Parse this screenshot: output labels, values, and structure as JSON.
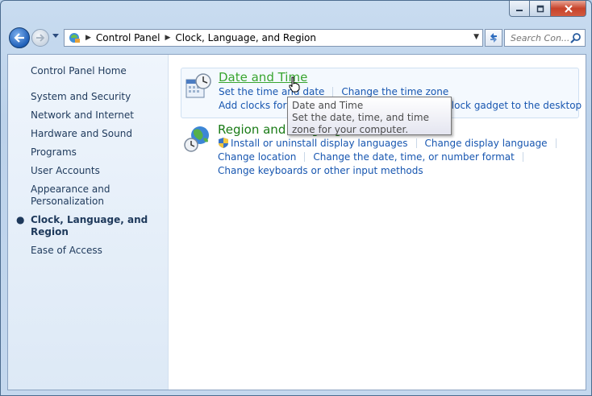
{
  "window": {
    "caption_buttons": {
      "minimize_icon": "minimize-icon",
      "maximize_icon": "maximize-icon",
      "close_icon": "close-icon"
    }
  },
  "navbar": {
    "back_icon": "back-arrow-icon",
    "forward_icon": "forward-arrow-icon",
    "breadcrumbs": [
      "Control Panel",
      "Clock, Language, and Region"
    ],
    "search_placeholder": "Search Con..."
  },
  "sidebar": {
    "home": "Control Panel Home",
    "items": [
      {
        "label": "System and Security",
        "active": false
      },
      {
        "label": "Network and Internet",
        "active": false
      },
      {
        "label": "Hardware and Sound",
        "active": false
      },
      {
        "label": "Programs",
        "active": false
      },
      {
        "label": "User Accounts",
        "active": false
      },
      {
        "label": "Appearance and Personalization",
        "active": false
      },
      {
        "label": "Clock, Language, and Region",
        "active": true
      },
      {
        "label": "Ease of Access",
        "active": false
      }
    ]
  },
  "categories": [
    {
      "title": "Date and Time",
      "links": [
        [
          "Set the time and date",
          "Change the time zone"
        ],
        [
          "Add clocks for different time zones",
          "Add the Clock gadget to the desktop"
        ]
      ]
    },
    {
      "title": "Region and Language",
      "links": [
        [
          "Install or uninstall display languages",
          "Change display language"
        ],
        [
          "Change location",
          "Change the date, time, or number format"
        ],
        [
          "Change keyboards or other input methods"
        ]
      ]
    }
  ],
  "tooltip": {
    "title": "Date and Time",
    "body": "Set the date, time, and time zone for your computer."
  },
  "colors": {
    "link": "#1756b0",
    "category_title": "#1a7b16",
    "sidebar_text": "#1e395b"
  }
}
